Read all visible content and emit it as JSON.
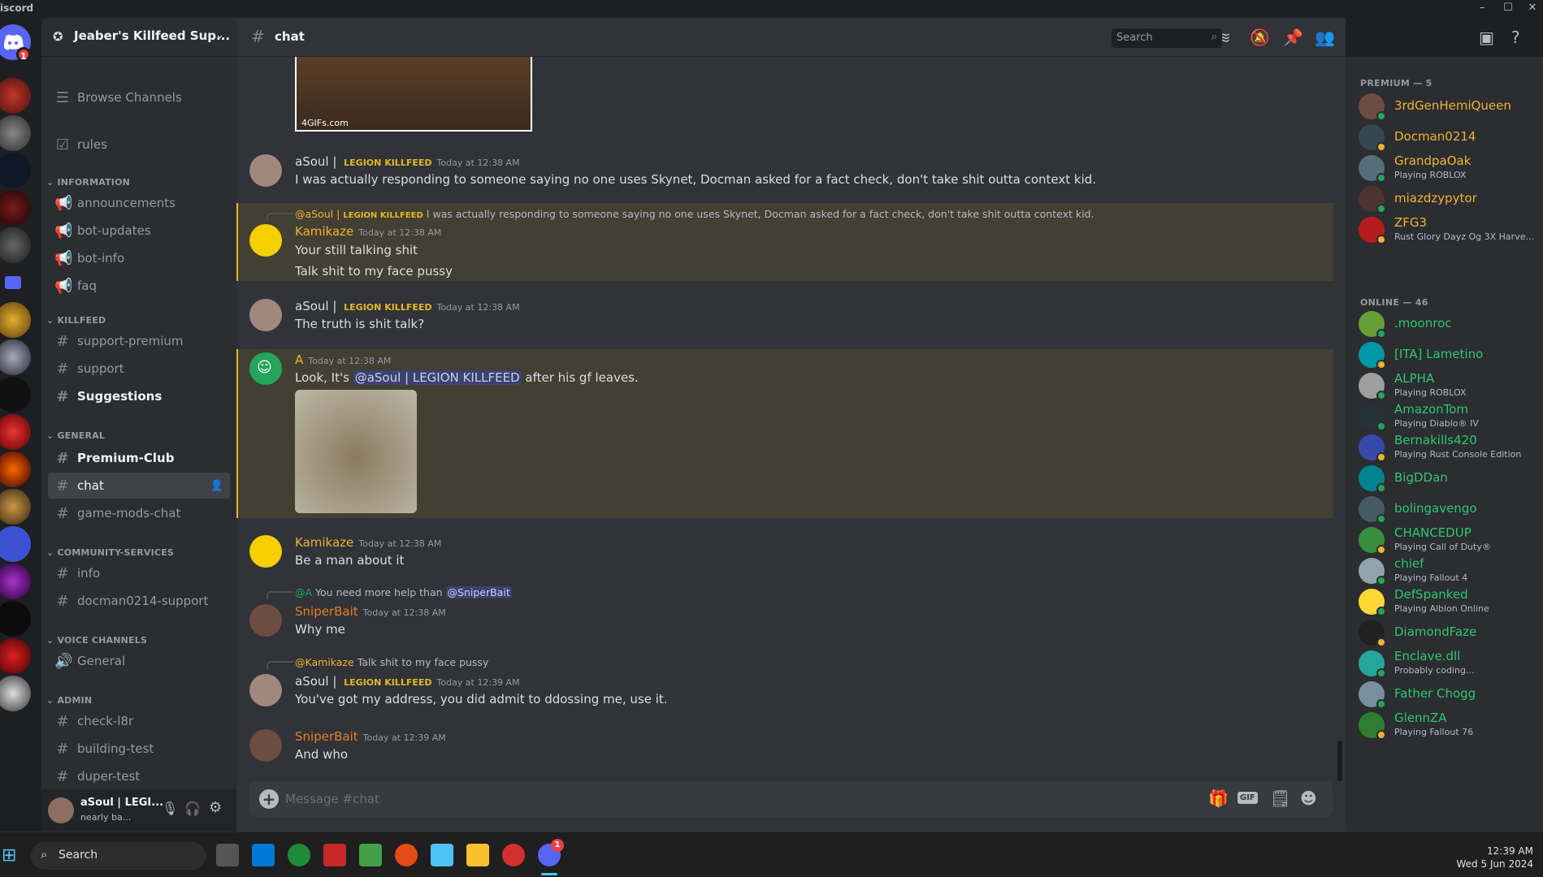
{
  "app": {
    "title": "iscord"
  },
  "server": {
    "name": "Jeaber's Killfeed Sup...",
    "rail_badge": "1"
  },
  "sidebar": {
    "browse": "Browse Channels",
    "rules": "rules",
    "categories": {
      "information": "INFORMATION",
      "killfeed": "KILLFEED",
      "general": "GENERAL",
      "community": "COMMUNITY-SERVICES",
      "voice": "VOICE CHANNELS",
      "admin": "ADMIN"
    },
    "channels": {
      "announcements": "announcements",
      "bot_updates": "bot-updates",
      "bot_info": "bot-info",
      "faq": "faq",
      "support_premium": "support-premium",
      "support": "support",
      "suggestions": "Suggestions",
      "premium_club": "Premium-Club",
      "chat": "chat",
      "game_mods_chat": "game-mods-chat",
      "info": "info",
      "docman_support": "docman0214-support",
      "general_voice": "General",
      "check_l8r": "check-l8r",
      "building_test": "building-test",
      "duper_test": "duper-test"
    }
  },
  "user": {
    "name": "aSoul | LEGI...",
    "status": "nearly ba..."
  },
  "header": {
    "channel": "chat",
    "search_placeholder": "Search"
  },
  "gif_watermark": "4GIFs.com",
  "messages": {
    "m1": {
      "author": "aSoul | ",
      "tag": "LEGION KILLFEED",
      "time": "Today at 12:38 AM",
      "text": "I was actually responding to someone saying no one uses Skynet, Docman asked for a fact check, don't take shit outta context kid."
    },
    "m2": {
      "reply_author": "@aSoul | ",
      "reply_tag": "LEGION KILLFEED",
      "reply_text": "I was actually responding to someone saying no one uses Skynet, Docman asked for a fact check, don't take shit outta context kid.",
      "author": "Kamikaze",
      "time": "Today at 12:38 AM",
      "text1": "Your still talking shit",
      "text2": "Talk shit to my face pussy"
    },
    "m3": {
      "author": "aSoul | ",
      "tag": "LEGION KILLFEED",
      "time": "Today at 12:38 AM",
      "text": "The truth is shit talk?"
    },
    "m4": {
      "author": "A",
      "time": "Today at 12:38 AM",
      "text_pre": "Look, It's ",
      "mention": "@aSoul | LEGION KILLFEED",
      "text_post": " after his gf leaves."
    },
    "m5": {
      "author": "Kamikaze",
      "time": "Today at 12:38 AM",
      "text": "Be a man about it"
    },
    "m6": {
      "reply_author": "@A",
      "reply_text": "You need more help than ",
      "reply_mention": "@SniperBait",
      "author": "SniperBait",
      "time": "Today at 12:38 AM",
      "text": "Why me"
    },
    "m7": {
      "reply_author": "@Kamikaze",
      "reply_text": "Talk shit to my face pussy",
      "author": "aSoul | ",
      "tag": "LEGION KILLFEED",
      "time": "Today at 12:39 AM",
      "text": "You've got my address, you did admit to ddossing me, use it."
    },
    "m8": {
      "author": "SniperBait",
      "time": "Today at 12:39 AM",
      "text": "And who"
    }
  },
  "composer": {
    "placeholder": "Message #chat"
  },
  "members": {
    "premium_header": "PREMIUM — 5",
    "online_header": "ONLINE — 46",
    "premium": [
      {
        "name": "3rdGenHemiQueen",
        "activity": ""
      },
      {
        "name": "Docman0214",
        "activity": ""
      },
      {
        "name": "GrandpaOak",
        "activity": "Playing ROBLOX"
      },
      {
        "name": "miazdzypytor",
        "activity": ""
      },
      {
        "name": "ZFG3",
        "activity": "Rust Glory Dayz Og 3X Harves..."
      }
    ],
    "online": [
      {
        "name": ".moonroc",
        "activity": ""
      },
      {
        "name": "[ITA] Lametino",
        "activity": ""
      },
      {
        "name": "ALPHA",
        "activity": "Playing ROBLOX"
      },
      {
        "name": "AmazonTom",
        "activity": "Playing Diablo® IV"
      },
      {
        "name": "Bernakills420",
        "activity": "Playing Rust Console Edition"
      },
      {
        "name": "BigDDan",
        "activity": ""
      },
      {
        "name": "bolingavengo",
        "activity": ""
      },
      {
        "name": "CHANCEDUP",
        "activity": "Playing Call of Duty®"
      },
      {
        "name": "chief",
        "activity": "Playing Fallout 4"
      },
      {
        "name": "DefSpanked",
        "activity": "Playing Albion Online"
      },
      {
        "name": "DiamondFaze",
        "activity": ""
      },
      {
        "name": "Enclave.dll",
        "activity": "Probably coding..."
      },
      {
        "name": "Father Chogg",
        "activity": ""
      },
      {
        "name": "GlennZA",
        "activity": "Playing Fallout 76"
      }
    ]
  },
  "taskbar": {
    "search": "Search",
    "time": "12:39 AM",
    "date": "Wed 5 Jun 2024",
    "discord_badge": "1"
  },
  "colors": {
    "premium_name": "#f0b232",
    "online_name": "#2dc770",
    "kamikaze": "#f0b232",
    "sniper": "#e67e22",
    "tag": "#e0b826",
    "highlight_bg": "#423f33"
  }
}
